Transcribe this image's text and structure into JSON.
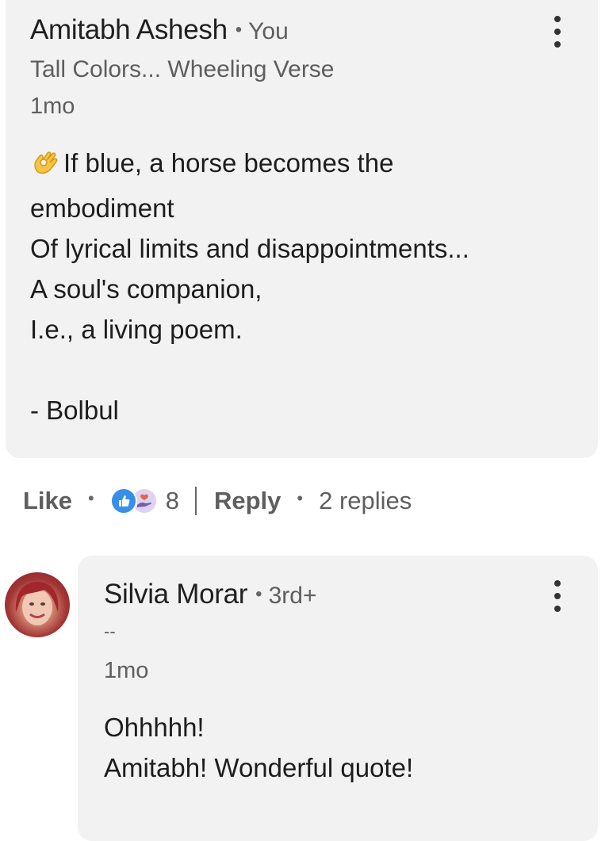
{
  "main_comment": {
    "author": "Amitabh Ashesh",
    "degree": "You",
    "headline": "Tall Colors... Wheeling Verse",
    "time": "1mo",
    "emoji": "ok-hand-emoji",
    "body": "If blue, a horse becomes the\nembodiment\nOf lyrical limits and disappointments...\nA soul's companion,\nI.e., a living poem.\n\n- Bolbul"
  },
  "actions": {
    "like_label": "Like",
    "reaction_count": "8",
    "reply_label": "Reply",
    "replies_label": "2 replies"
  },
  "reply_comment": {
    "author": "Silvia Morar",
    "degree": "3rd+",
    "headline": "--",
    "time": "1mo",
    "body": "Ohhhhh!\nAmitabh! Wonderful quote!"
  },
  "colors": {
    "card_bg": "#f2f2f2",
    "like_blue": "#378fe9",
    "love_bg": "#dfd3f2",
    "muted_text": "#5e5e5e"
  }
}
